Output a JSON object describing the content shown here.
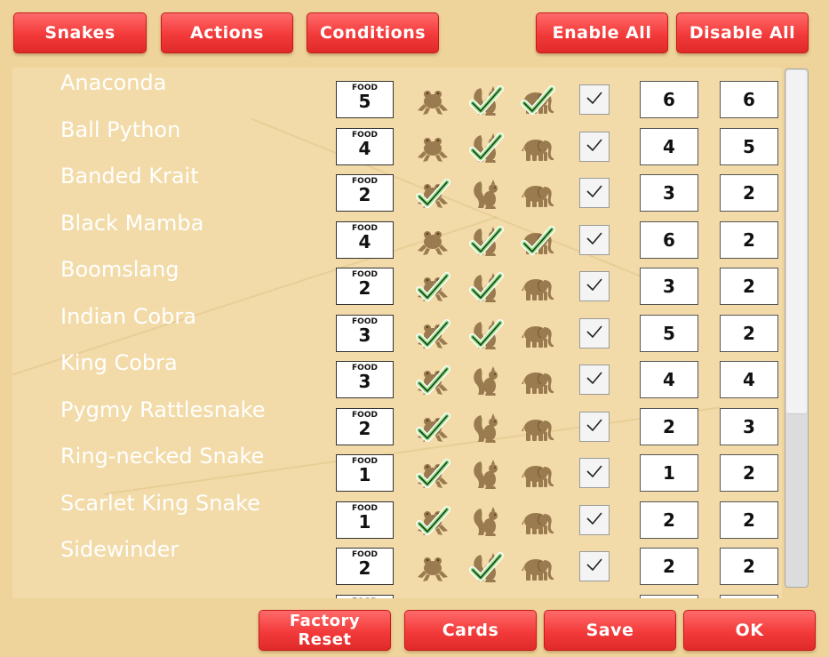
{
  "top_buttons": {
    "snakes": "Snakes",
    "actions": "Actions",
    "conditions": "Conditions",
    "enable_all": "Enable All",
    "disable_all": "Disable All"
  },
  "bottom_buttons": {
    "factory_reset_line1": "Factory",
    "factory_reset_line2": "Reset",
    "cards": "Cards",
    "save": "Save",
    "ok": "OK"
  },
  "food_label": "FOOD",
  "icons": [
    "frog-icon",
    "squirrel-icon",
    "elephant-icon",
    "checkmark-icon"
  ],
  "colors": {
    "button": "#f33a3a",
    "background": "#eed49a",
    "icon": "#9a7a4f",
    "check": "#1e3a10"
  },
  "snakes": [
    {
      "name": "Anaconda",
      "food": "5",
      "frog": false,
      "squirrel": true,
      "elephant": true,
      "enabled": true,
      "a": "6",
      "b": "6"
    },
    {
      "name": "Ball Python",
      "food": "4",
      "frog": false,
      "squirrel": true,
      "elephant": false,
      "enabled": true,
      "a": "4",
      "b": "5"
    },
    {
      "name": "Banded Krait",
      "food": "2",
      "frog": true,
      "squirrel": false,
      "elephant": false,
      "enabled": true,
      "a": "3",
      "b": "2"
    },
    {
      "name": "Black Mamba",
      "food": "4",
      "frog": false,
      "squirrel": true,
      "elephant": true,
      "enabled": true,
      "a": "6",
      "b": "2"
    },
    {
      "name": "Boomslang",
      "food": "2",
      "frog": true,
      "squirrel": true,
      "elephant": false,
      "enabled": true,
      "a": "3",
      "b": "2"
    },
    {
      "name": "Indian Cobra",
      "food": "3",
      "frog": true,
      "squirrel": true,
      "elephant": false,
      "enabled": true,
      "a": "5",
      "b": "2"
    },
    {
      "name": "King Cobra",
      "food": "3",
      "frog": true,
      "squirrel": false,
      "elephant": false,
      "enabled": true,
      "a": "4",
      "b": "4"
    },
    {
      "name": "Pygmy Rattlesnake",
      "food": "2",
      "frog": true,
      "squirrel": false,
      "elephant": false,
      "enabled": true,
      "a": "2",
      "b": "3"
    },
    {
      "name": "Ring-necked Snake",
      "food": "1",
      "frog": true,
      "squirrel": false,
      "elephant": false,
      "enabled": true,
      "a": "1",
      "b": "2"
    },
    {
      "name": "Scarlet King Snake",
      "food": "1",
      "frog": true,
      "squirrel": false,
      "elephant": false,
      "enabled": true,
      "a": "2",
      "b": "2"
    },
    {
      "name": "Sidewinder",
      "food": "2",
      "frog": false,
      "squirrel": true,
      "elephant": false,
      "enabled": true,
      "a": "2",
      "b": "2"
    },
    {
      "name": "",
      "food": "",
      "frog": false,
      "squirrel": false,
      "elephant": false,
      "enabled": true,
      "a": "",
      "b": ""
    }
  ]
}
